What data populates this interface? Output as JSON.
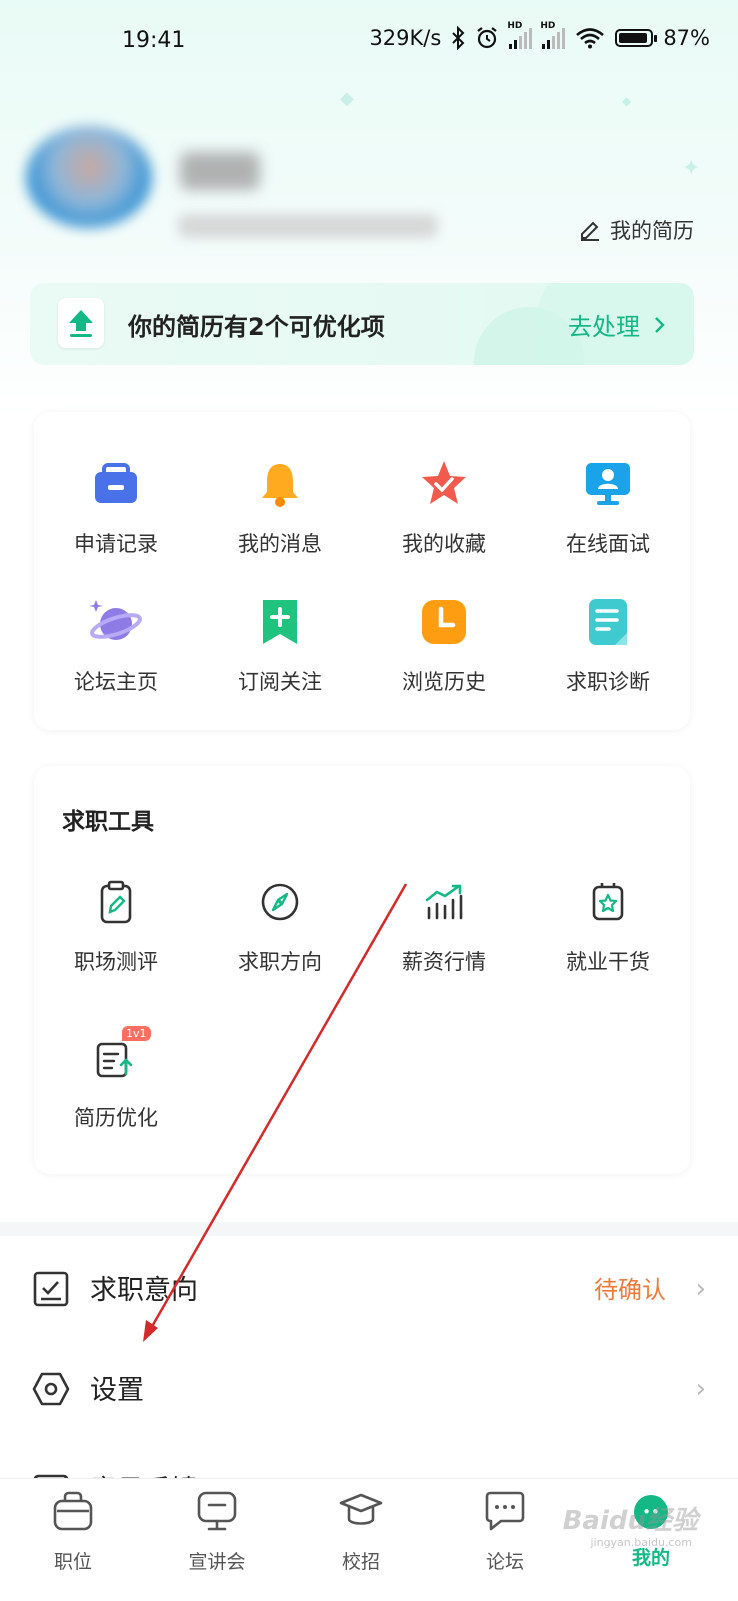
{
  "status_bar": {
    "time": "19:41",
    "speed": "329K/s",
    "signal_label_1": "HD",
    "signal_label_2": "HD",
    "battery": "87%"
  },
  "profile": {
    "resume_link": "我的简历"
  },
  "banner": {
    "title": "你的简历有2个可优化项",
    "action": "去处理",
    "accent_color": "#13b884"
  },
  "quick_grid": {
    "items": [
      {
        "label": "申请记录",
        "icon": "briefcase-icon"
      },
      {
        "label": "我的消息",
        "icon": "bell-icon"
      },
      {
        "label": "我的收藏",
        "icon": "star-icon"
      },
      {
        "label": "在线面试",
        "icon": "monitor-person-icon"
      },
      {
        "label": "论坛主页",
        "icon": "planet-icon"
      },
      {
        "label": "订阅关注",
        "icon": "bookmark-plus-icon"
      },
      {
        "label": "浏览历史",
        "icon": "clock-icon"
      },
      {
        "label": "求职诊断",
        "icon": "document-icon"
      }
    ]
  },
  "tools": {
    "title": "求职工具",
    "items": [
      {
        "label": "职场测评",
        "icon": "clipboard-pen-icon"
      },
      {
        "label": "求职方向",
        "icon": "compass-icon"
      },
      {
        "label": "薪资行情",
        "icon": "chart-trend-icon"
      },
      {
        "label": "就业干货",
        "icon": "gift-star-icon"
      },
      {
        "label": "简历优化",
        "icon": "resume-upload-icon",
        "badge": "1v1"
      }
    ]
  },
  "menu": {
    "intent": {
      "label": "求职意向",
      "value": "待确认",
      "value_color": "#f07a3a"
    },
    "settings": {
      "label": "设置"
    },
    "feedback": {
      "label": "意见反馈"
    }
  },
  "bottom_nav": {
    "items": [
      {
        "label": "职位",
        "icon": "bag-icon"
      },
      {
        "label": "宣讲会",
        "icon": "screen-icon"
      },
      {
        "label": "校招",
        "icon": "graduation-cap-icon"
      },
      {
        "label": "论坛",
        "icon": "chat-bubble-icon"
      },
      {
        "label": "我的",
        "icon": "profile-dot-icon",
        "active": true
      }
    ]
  },
  "watermark": {
    "text": "Baidu经验",
    "sub": "jingyan.baidu.com"
  }
}
